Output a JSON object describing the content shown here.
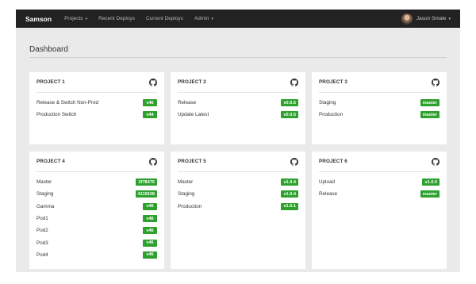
{
  "nav": {
    "brand": "Samson",
    "items": [
      {
        "label": "Projects",
        "caret": "▾"
      },
      {
        "label": "Recent Deploys"
      },
      {
        "label": "Current Deploys"
      },
      {
        "label": "Admin",
        "caret": "▾"
      }
    ],
    "user": {
      "name": "Jason Smale",
      "caret": "▾"
    }
  },
  "page": {
    "title": "Dashboard"
  },
  "colors": {
    "badge": "#2da02d",
    "navbar": "#222222",
    "background": "#eaeaea"
  },
  "projects": [
    {
      "title": "PROJECT 1",
      "icon": "github-icon",
      "stages": [
        {
          "name": "Release & Switch Non-Prod",
          "version": "v46"
        },
        {
          "name": "Production Switch",
          "version": "v44"
        }
      ]
    },
    {
      "title": "PROJECT 2",
      "icon": "github-icon",
      "stages": [
        {
          "name": "Release",
          "version": "v0.0.5"
        },
        {
          "name": "Update Latest",
          "version": "v0.0.5"
        }
      ]
    },
    {
      "title": "PROJECT 3",
      "icon": "github-icon",
      "stages": [
        {
          "name": "Staging",
          "version": "master"
        },
        {
          "name": "Production",
          "version": "master"
        }
      ]
    },
    {
      "title": "PROJECT 4",
      "icon": "github-icon",
      "stages": [
        {
          "name": "Master",
          "version": "2f78476"
        },
        {
          "name": "Staging",
          "version": "4115628"
        },
        {
          "name": "Gamma",
          "version": "v46"
        },
        {
          "name": "Pod1",
          "version": "v46"
        },
        {
          "name": "Pod2",
          "version": "v46"
        },
        {
          "name": "Pod3",
          "version": "v46"
        },
        {
          "name": "Pod4",
          "version": "v46"
        }
      ]
    },
    {
      "title": "PROJECT 5",
      "icon": "github-icon",
      "stages": [
        {
          "name": "Master",
          "version": "v1.0.4"
        },
        {
          "name": "Staging",
          "version": "v1.0.4"
        },
        {
          "name": "Production",
          "version": "v1.0.1"
        }
      ]
    },
    {
      "title": "PROJECT 6",
      "icon": "github-icon",
      "stages": [
        {
          "name": "Upload",
          "version": "v1.0.0"
        },
        {
          "name": "Release",
          "version": "master"
        }
      ]
    }
  ]
}
